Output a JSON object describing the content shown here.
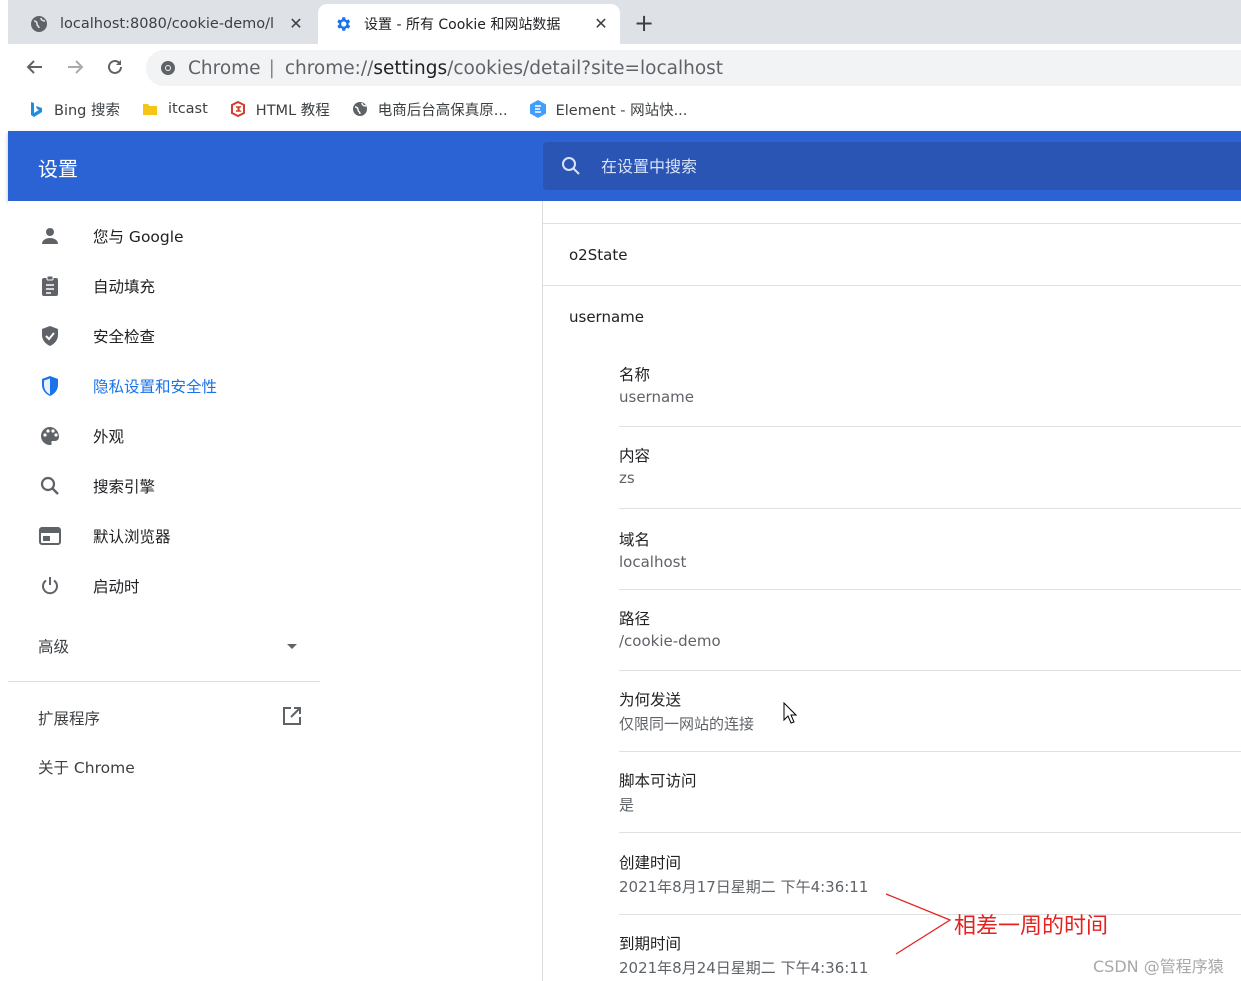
{
  "browser": {
    "tabs": [
      {
        "title": "localhost:8080/cookie-demo/l",
        "icon": "globe-icon"
      },
      {
        "title": "设置 - 所有 Cookie 和网站数据",
        "icon": "gear-icon"
      }
    ],
    "close_glyph": "✕",
    "new_tab_glyph": "+",
    "omnibox": {
      "chip": "Chrome",
      "separator": "|",
      "url_prefix": "chrome://",
      "url_host": "settings",
      "url_rest": "/cookies/detail?site=localhost"
    },
    "bookmarks": [
      {
        "label": "Bing 搜索",
        "icon": "bing-icon"
      },
      {
        "label": "itcast",
        "icon": "folder-icon"
      },
      {
        "label": "HTML 教程",
        "icon": "runoob-icon"
      },
      {
        "label": "电商后台高保真原...",
        "icon": "globe-icon"
      },
      {
        "label": "Element - 网站快...",
        "icon": "element-icon"
      }
    ]
  },
  "settings": {
    "title": "设置",
    "search_placeholder": "在设置中搜索",
    "nav": [
      {
        "label": "您与 Google",
        "icon": "person-icon",
        "active": false
      },
      {
        "label": "自动填充",
        "icon": "clipboard-icon",
        "active": false
      },
      {
        "label": "安全检查",
        "icon": "shield-check-icon",
        "active": false
      },
      {
        "label": "隐私设置和安全性",
        "icon": "privacy-shield-icon",
        "active": true
      },
      {
        "label": "外观",
        "icon": "palette-icon",
        "active": false
      },
      {
        "label": "搜索引擎",
        "icon": "search-icon",
        "active": false
      },
      {
        "label": "默认浏览器",
        "icon": "browser-window-icon",
        "active": false
      },
      {
        "label": "启动时",
        "icon": "power-icon",
        "active": false
      }
    ],
    "advanced_label": "高级",
    "extensions_label": "扩展程序",
    "about_label": "关于 Chrome"
  },
  "cookie_detail": {
    "previous_cookie": "o2State",
    "cookie_name": "username",
    "fields": [
      {
        "label": "名称",
        "value": "username"
      },
      {
        "label": "内容",
        "value": "zs"
      },
      {
        "label": "域名",
        "value": "localhost"
      },
      {
        "label": "路径",
        "value": "/cookie-demo"
      },
      {
        "label": "为何发送",
        "value": "仅限同一网站的连接"
      },
      {
        "label": "脚本可访问",
        "value": "是"
      },
      {
        "label": "创建时间",
        "value": "2021年8月17日星期二 下午4:36:11"
      },
      {
        "label": "到期时间",
        "value": "2021年8月24日星期二 下午4:36:11"
      }
    ]
  },
  "annotation": {
    "text": "相差一周的时间",
    "color": "#e4231f"
  },
  "watermark": "CSDN @管程序猿",
  "colors": {
    "header": "#2c63d4",
    "active_nav": "#1a73e8"
  }
}
